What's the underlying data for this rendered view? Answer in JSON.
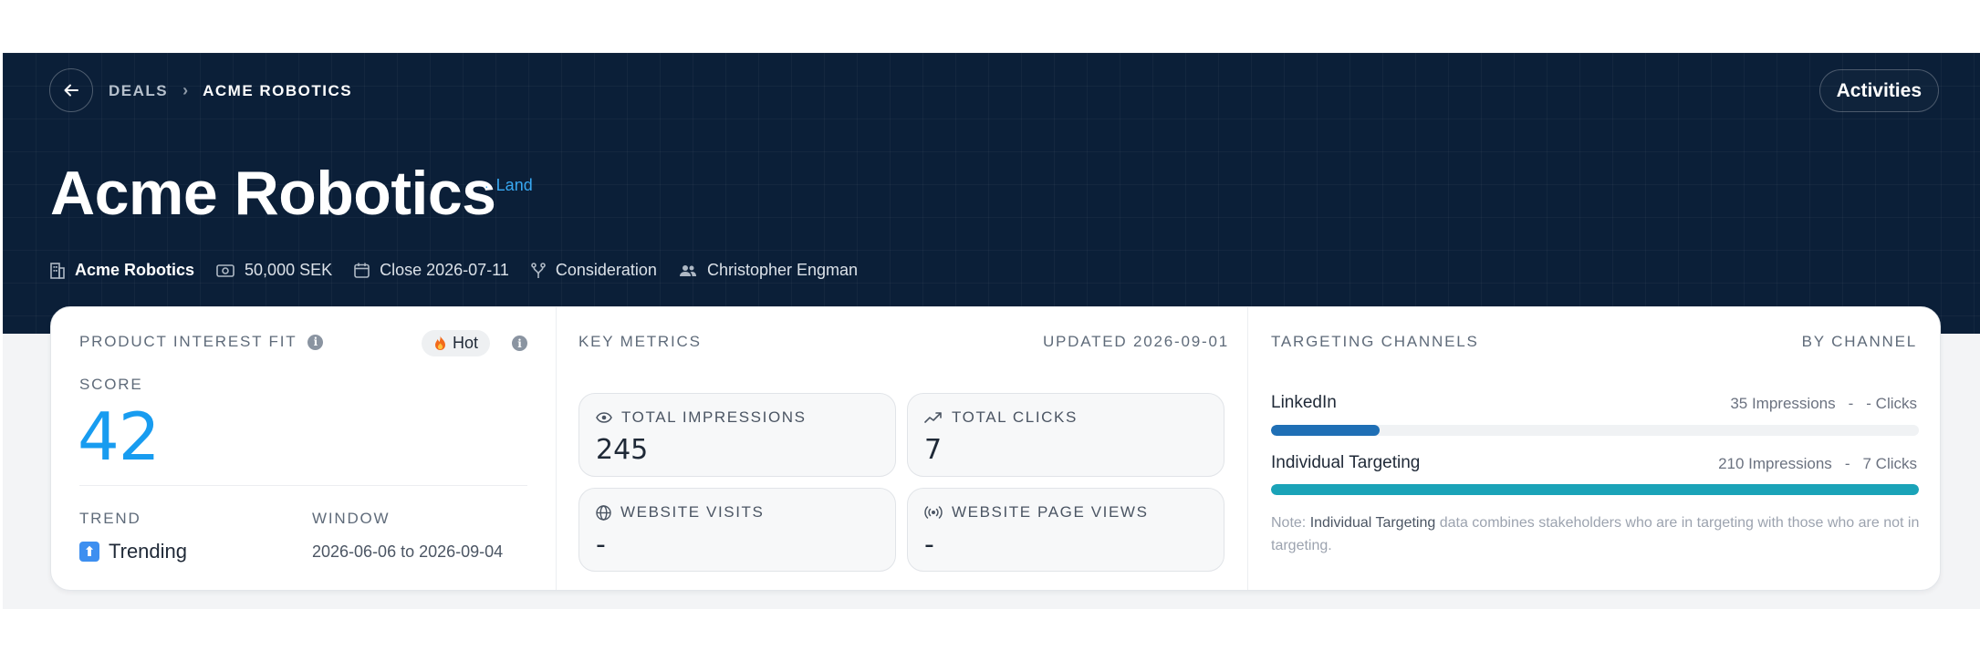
{
  "breadcrumb": {
    "parent": "DEALS",
    "separator": "›",
    "current": "ACME ROBOTICS"
  },
  "header": {
    "title": "Acme Robotics",
    "tag": "Land",
    "tag_dot": "·",
    "activities_label": "Activities",
    "meta": {
      "company": "Acme Robotics",
      "amount": "50,000 SEK",
      "close": "Close 2026-07-11",
      "stage": "Consideration",
      "owner": "Christopher Engman"
    }
  },
  "product_interest": {
    "title": "PRODUCT INTEREST FIT",
    "badge": "Hot",
    "score_label": "SCORE",
    "score": "42",
    "trend_label": "TREND",
    "trend_value": "Trending",
    "window_label": "WINDOW",
    "window_value": "2026-06-06 to 2026-09-04"
  },
  "key_metrics": {
    "title": "KEY METRICS",
    "updated": "UPDATED 2026-09-01",
    "items": [
      {
        "label": "TOTAL IMPRESSIONS",
        "value": "245",
        "icon": "eye-icon"
      },
      {
        "label": "TOTAL CLICKS",
        "value": "7",
        "icon": "trend-line-icon"
      },
      {
        "label": "WEBSITE VISITS",
        "value": "-",
        "icon": "globe-icon"
      },
      {
        "label": "WEBSITE PAGE VIEWS",
        "value": "-",
        "icon": "broadcast-icon"
      }
    ]
  },
  "targeting": {
    "title": "TARGETING CHANNELS",
    "by": "BY CHANNEL",
    "channels": [
      {
        "name": "LinkedIn",
        "impressions": "35 Impressions",
        "sep": "-",
        "clicks": "- Clicks",
        "share": 0.167,
        "color": "#1f6fb5"
      },
      {
        "name": "Individual Targeting",
        "impressions": "210 Impressions",
        "sep": "-",
        "clicks": "7 Clicks",
        "share": 1.0,
        "color": "#1aa3b8"
      }
    ],
    "note_prefix": "Note: ",
    "note_strong": "Individual Targeting",
    "note_rest": " data combines stakeholders who are in targeting with those who are not in targeting."
  }
}
